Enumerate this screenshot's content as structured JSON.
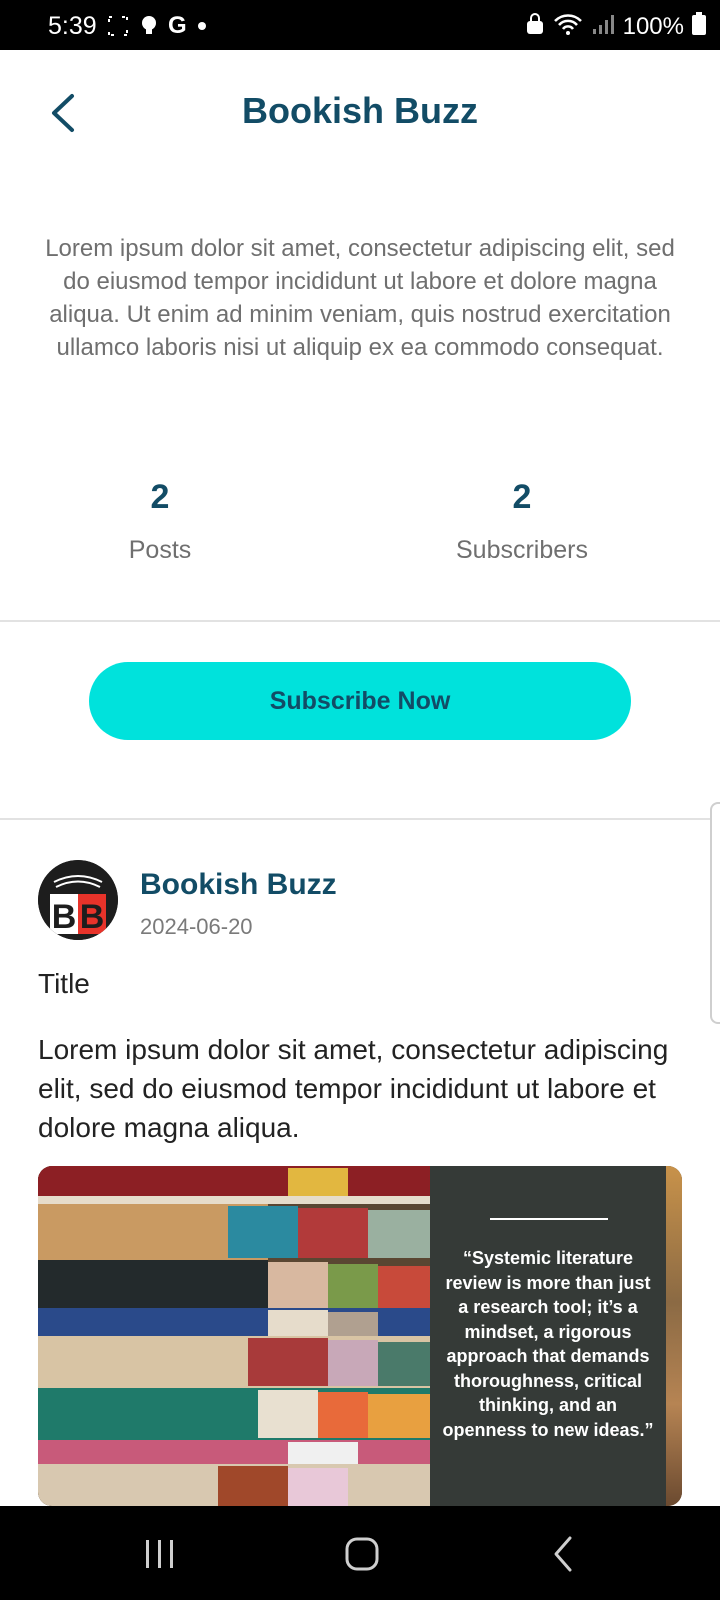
{
  "status_bar": {
    "time": "5:39",
    "g_label": "G",
    "battery": "100%",
    "icons": [
      "screenshot-icon",
      "bulb-icon",
      "google-icon",
      "dot-icon",
      "lock-icon",
      "wifi-icon",
      "signal-icon",
      "battery-icon"
    ]
  },
  "header": {
    "title": "Bookish Buzz",
    "back_icon": "chevron-left-icon"
  },
  "description": "Lorem ipsum dolor sit amet, consectetur adipiscing elit, sed do eiusmod tempor incididunt ut labore et dolore magna aliqua. Ut enim ad minim veniam, quis nostrud exercitation ullamco laboris nisi ut aliquip ex ea commodo consequat.",
  "stats": {
    "posts": {
      "value": "2",
      "label": "Posts"
    },
    "subscribers": {
      "value": "2",
      "label": "Subscribers"
    }
  },
  "subscribe_label": "Subscribe Now",
  "post": {
    "avatar_text": "BB",
    "author": "Bookish Buzz",
    "date": "2024-06-20",
    "title": "Title",
    "body": "Lorem ipsum dolor sit amet, consectetur adipiscing elit, sed do eiusmod tempor incididunt ut labore et dolore magna aliqua.",
    "image": {
      "description_icon": "stacked-books-photo",
      "quote": "“Systemic literature review is more than just a research tool; it’s a mindset, a rigorous approach that demands thoroughness, critical thinking, and an openness to new ideas.”"
    }
  },
  "nav": {
    "recents_icon": "recents-icon",
    "home_icon": "home-icon",
    "back_icon": "back-icon"
  },
  "colors": {
    "primary": "#124c66",
    "accent": "#00e2dc",
    "muted_text": "#6f6f6f"
  }
}
